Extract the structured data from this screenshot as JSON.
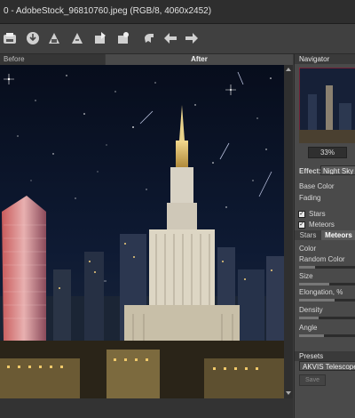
{
  "window": {
    "title": "0 - AdobeStock_96810760.jpeg (RGB/8, 4060x2452)"
  },
  "toolbar": {
    "icons": [
      "open-icon",
      "save-icon",
      "print-icon",
      "share-icon",
      "batch-icon",
      "settings-icon",
      "hand-icon",
      "undo-icon",
      "redo-icon"
    ]
  },
  "view_tabs": {
    "before": "Before",
    "after": "After"
  },
  "navigator": {
    "title": "Navigator",
    "zoom": "33%"
  },
  "effect": {
    "label": "Effect:",
    "value": "Night Sky (R"
  },
  "settings": {
    "base_color": "Base Color",
    "fading": "Fading",
    "stars_check": "Stars",
    "meteors_check": "Meteors"
  },
  "subtabs": {
    "stars": "Stars",
    "meteors": "Meteors"
  },
  "meteors": {
    "color": "Color",
    "random_color": "Random Color",
    "size": "Size",
    "elongation": "Elongation, %",
    "density": "Density",
    "angle": "Angle"
  },
  "presets": {
    "title": "Presets",
    "selected": "AKVIS Telescope",
    "save": "Save"
  },
  "colors": {
    "accent": "#c9a54a",
    "panel": "#4a4a4a",
    "sky": "#0b1426"
  }
}
